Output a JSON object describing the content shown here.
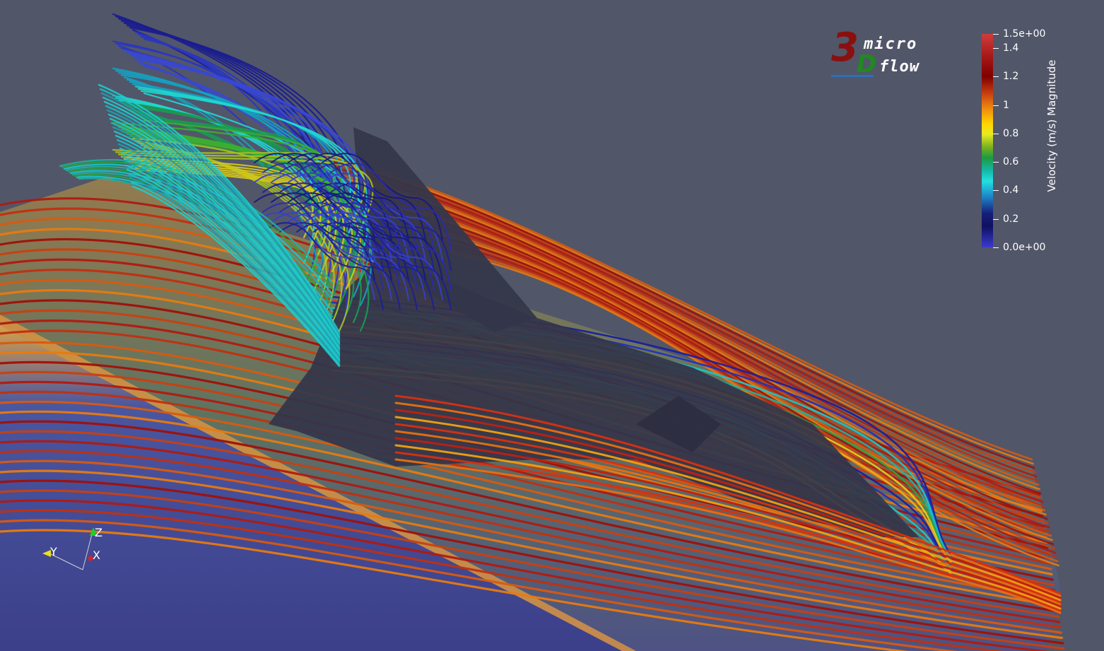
{
  "logo": {
    "digit": "3",
    "letter": "D",
    "word_top": "micro",
    "word_bottom": "flow"
  },
  "colorbar": {
    "title": "Velocity (m/s) Magnitude",
    "range": [
      0,
      1.5
    ],
    "ticks": [
      {
        "value": 1.5,
        "label": "1.5e+00"
      },
      {
        "value": 1.4,
        "label": "1.4"
      },
      {
        "value": 1.2,
        "label": "1.2"
      },
      {
        "value": 1.0,
        "label": "1"
      },
      {
        "value": 0.8,
        "label": "0.8"
      },
      {
        "value": 0.6,
        "label": "0.6"
      },
      {
        "value": 0.4,
        "label": "0.4"
      },
      {
        "value": 0.2,
        "label": "0.2"
      },
      {
        "value": 0.0,
        "label": "0.0e+00"
      }
    ],
    "colormap": [
      "#3a3ad0",
      "#101060",
      "#1e88c8",
      "#22e0e0",
      "#1d9a40",
      "#e8ea20",
      "#f08a10",
      "#800000",
      "#d03c3c"
    ]
  },
  "axes": {
    "y_label": "Y",
    "z_label": "Z",
    "x_label": "X",
    "y_color": "#e8e020",
    "z_color": "#20d020",
    "x_color": "#e02020"
  },
  "scene": {
    "background": "#525669",
    "model_color": "#35374a",
    "ground_color": "#3d3f8a"
  }
}
